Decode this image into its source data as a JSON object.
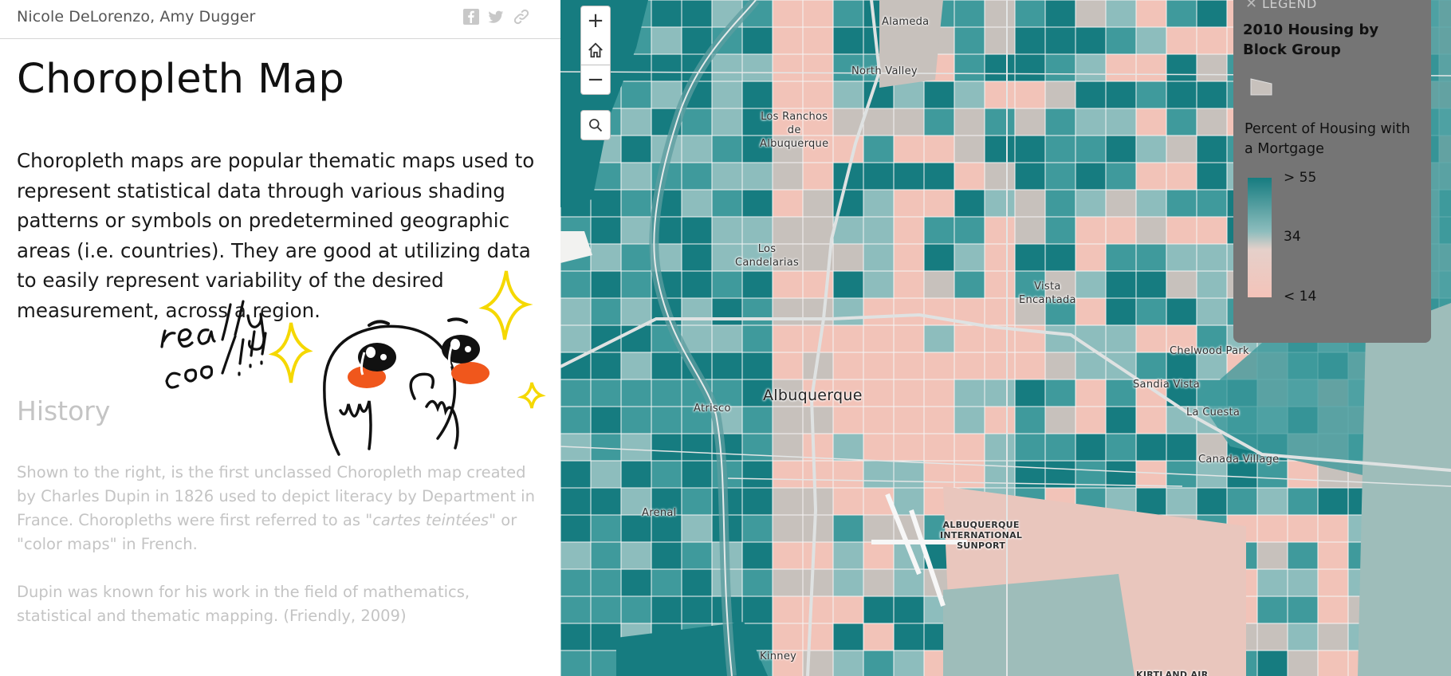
{
  "story": {
    "authors": "Nicole DeLorenzo, Amy Dugger",
    "share": {
      "facebook_icon": "facebook-icon",
      "twitter_icon": "twitter-icon",
      "link_icon": "link-icon"
    },
    "title": "Choropleth Map",
    "intro": "Choropleth maps are popular thematic maps used to represent statistical data through various shading patterns or symbols on predetermined geographic areas (i.e. countries). They are good at utilizing data to easily represent variability of the desired measurement, across a region.",
    "doodle_text": "really\ncool!!!",
    "history_heading": "History",
    "history_p1_before": "Shown to the right, is the first unclassed Choropleth map created by Charles Dupin in 1826 used to depict literacy by Department in France. Choropleths were first referred to as \"",
    "history_p1_italic": "cartes teintées",
    "history_p1_after": "\" or \"color maps\" in French.",
    "history_p2": "Dupin was known for his work in the field of mathematics, statistical and thematic mapping. (Friendly, 2009)"
  },
  "map": {
    "controls": {
      "zoom_in": "+",
      "zoom_out": "−",
      "home_icon": "home-icon",
      "search_icon": "search-icon"
    },
    "places": {
      "alameda": "Alameda",
      "north_valley": "North Valley",
      "los_ranchos": "Los Ranchos\nde\nAlbuquerque",
      "los_candelarias": "Los\nCandelarias",
      "vista_encantada": "Vista\nEncantada",
      "chelwood_park": "Chelwood Park",
      "sandia_vista": "Sandia Vista",
      "la_cuesta": "La Cuesta",
      "canada_village": "Canada Village",
      "atrisco": "Atrisco",
      "albuquerque": "Albuquerque",
      "arenal": "Arenal",
      "airport": "ALBUQUERQUE\nINTERNATIONAL\nSUNPORT",
      "kinney": "Kinney",
      "kirtland": "KIRTLAND AIR"
    },
    "colors": {
      "high": "#167c80",
      "mid_high": "#3f9a9c",
      "mid": "#8dbdbd",
      "neutral": "#c7c1bc",
      "low": "#f2c3b8"
    }
  },
  "legend": {
    "title": "LEGEND",
    "close": "✕",
    "layer_name": "2010 Housing by Block Group",
    "field_name": "Percent of Housing with a Mortgage",
    "high_label": "> 55",
    "mid_label": "34",
    "low_label": "< 14"
  }
}
